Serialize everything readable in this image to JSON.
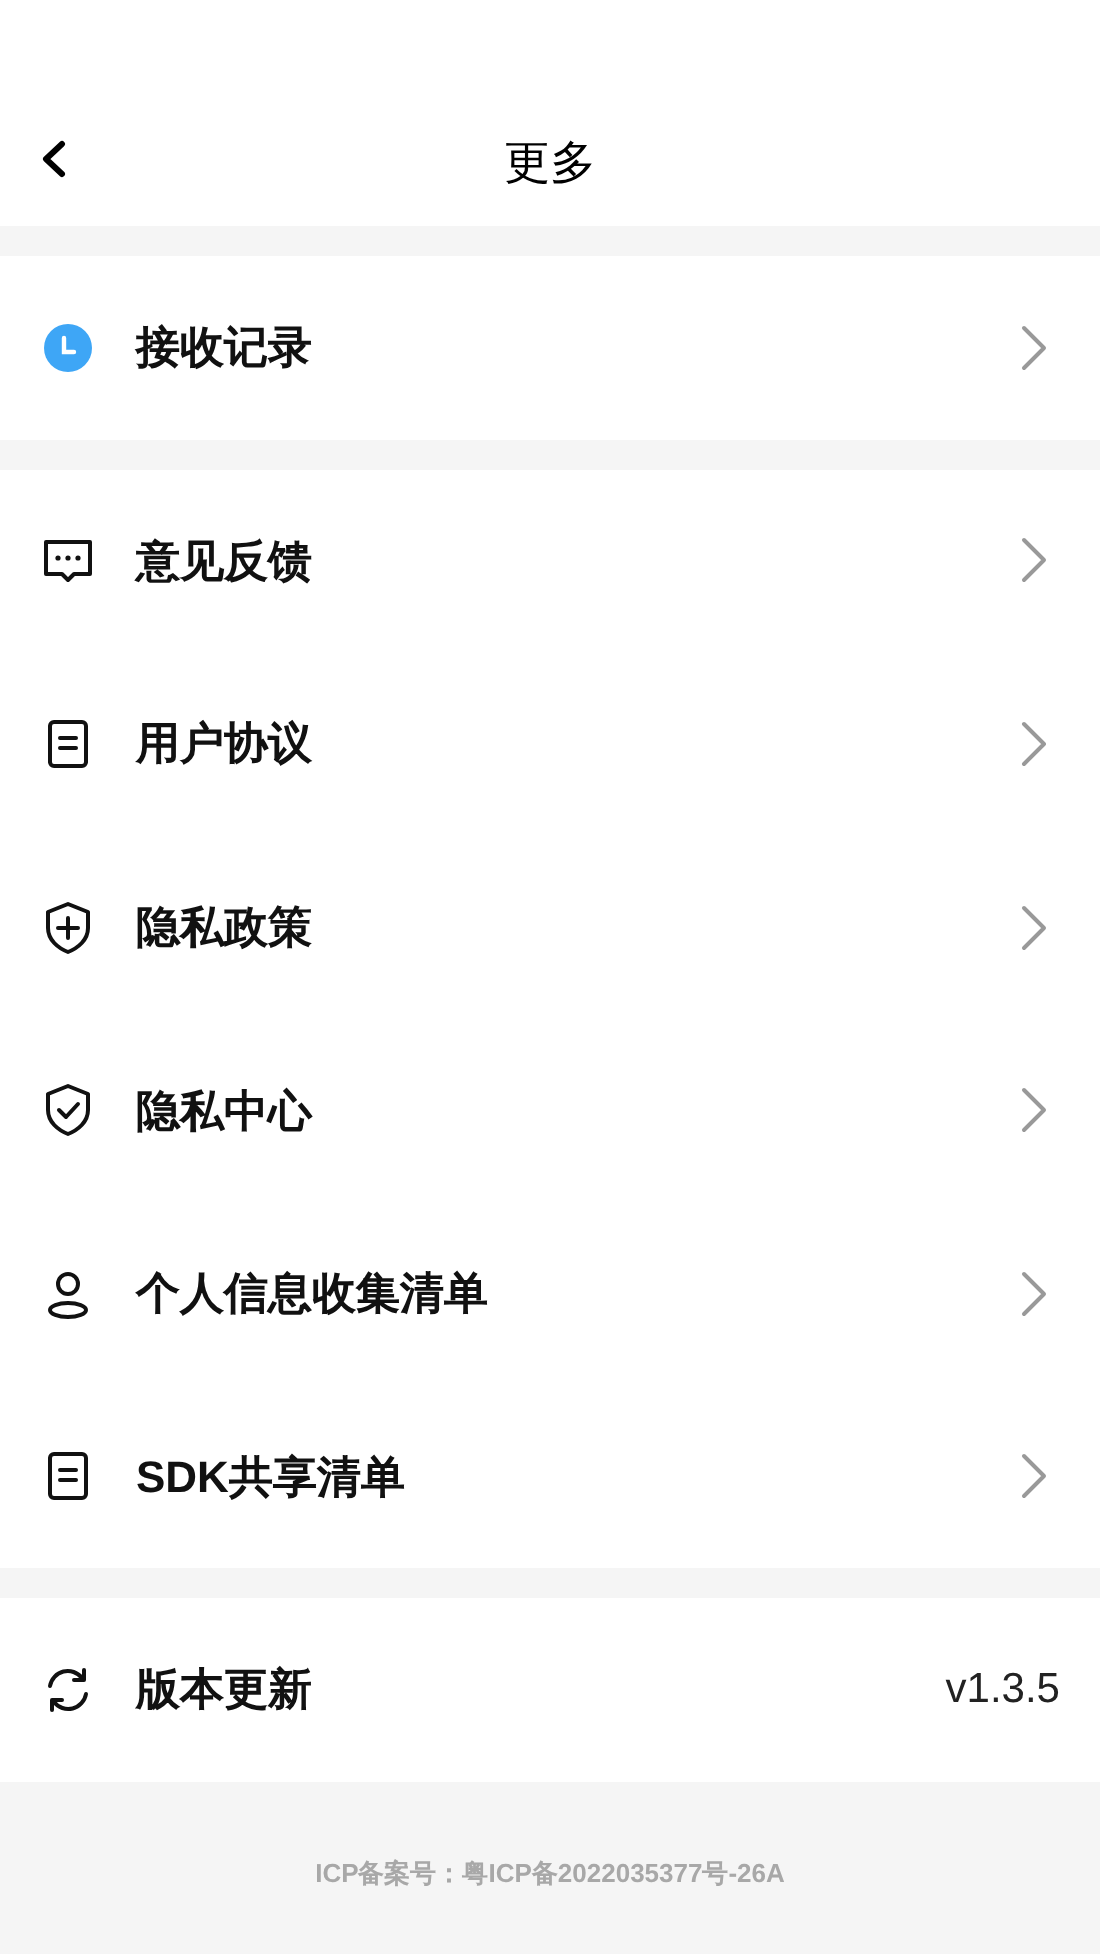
{
  "header": {
    "title": "更多"
  },
  "sections": [
    {
      "items": [
        {
          "kind": "link",
          "label": "接收记录"
        }
      ]
    },
    {
      "items": [
        {
          "kind": "link",
          "label": "意见反馈"
        },
        {
          "kind": "link",
          "label": "用户协议"
        },
        {
          "kind": "link",
          "label": "隐私政策"
        },
        {
          "kind": "link",
          "label": "隐私中心"
        },
        {
          "kind": "link",
          "label": "个人信息收集清单"
        },
        {
          "kind": "link",
          "label": "SDK共享清单"
        }
      ]
    },
    {
      "items": [
        {
          "kind": "value",
          "label": "版本更新",
          "value": "v1.3.5"
        }
      ]
    }
  ],
  "footer": "ICP备案号：粤ICP备2022035377号-26A"
}
